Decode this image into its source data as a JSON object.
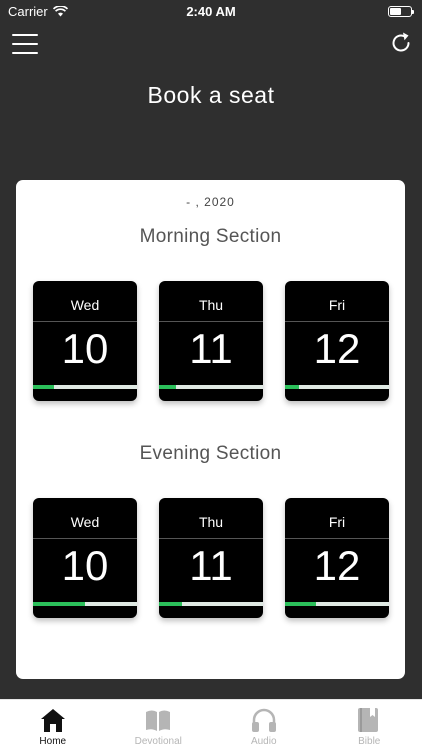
{
  "status_bar": {
    "carrier": "Carrier",
    "time": "2:40 AM",
    "battery_level": 0.55
  },
  "header": {
    "title": "Book a seat"
  },
  "card": {
    "date": "- , 2020",
    "morning": {
      "title": "Morning Section",
      "days": [
        {
          "day": "Wed",
          "date": "10",
          "booked_fraction": 0.2
        },
        {
          "day": "Thu",
          "date": "11",
          "booked_fraction": 0.16
        },
        {
          "day": "Fri",
          "date": "12",
          "booked_fraction": 0.13
        }
      ]
    },
    "evening": {
      "title": "Evening Section",
      "days": [
        {
          "day": "Wed",
          "date": "10",
          "booked_fraction": 0.5
        },
        {
          "day": "Thu",
          "date": "11",
          "booked_fraction": 0.22
        },
        {
          "day": "Fri",
          "date": "12",
          "booked_fraction": 0.3
        }
      ]
    }
  },
  "tabs": [
    {
      "label": "Home",
      "icon": "home-icon",
      "active": true
    },
    {
      "label": "Devotional",
      "icon": "book-open-icon",
      "active": false
    },
    {
      "label": "Audio",
      "icon": "headphones-icon",
      "active": false
    },
    {
      "label": "Bible",
      "icon": "bible-icon",
      "active": false
    }
  ],
  "colors": {
    "background": "#2f2f2f",
    "progress": "#2bbf5a",
    "progress_track": "#dfe9e3",
    "tab_inactive": "#b5b5b5"
  }
}
